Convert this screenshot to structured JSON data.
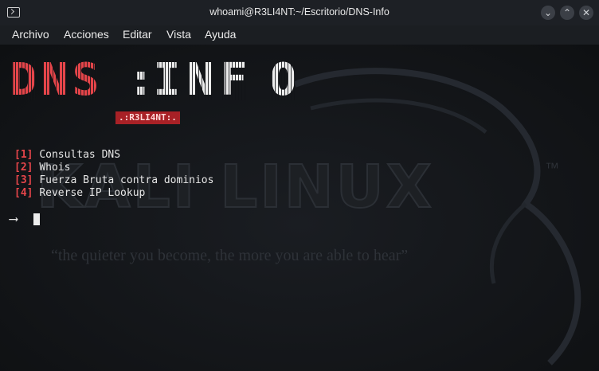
{
  "window": {
    "title": "whoami@R3LI4NT:~/Escritorio/DNS-Info"
  },
  "menubar": {
    "items": [
      "Archivo",
      "Acciones",
      "Editar",
      "Vista",
      "Ayuda"
    ]
  },
  "background": {
    "logo": "KALI LINUX",
    "tm": "™",
    "quote": "“the quieter you become, the more you are able to hear”"
  },
  "banner": {
    "left": [
      "D",
      "N",
      "S"
    ],
    "sep": ":",
    "right": [
      "I",
      "N",
      "F",
      "O"
    ],
    "tag": ".:R3LI4NT:."
  },
  "options": [
    {
      "num": "1",
      "label": "Consultas DNS"
    },
    {
      "num": "2",
      "label": "Whois"
    },
    {
      "num": "3",
      "label": "Fuerza Bruta contra dominios"
    },
    {
      "num": "4",
      "label": "Reverse IP Lookup"
    }
  ],
  "prompt": "⟶",
  "colors": {
    "accent_red": "#e5454a",
    "tag_bg": "#a82126"
  }
}
